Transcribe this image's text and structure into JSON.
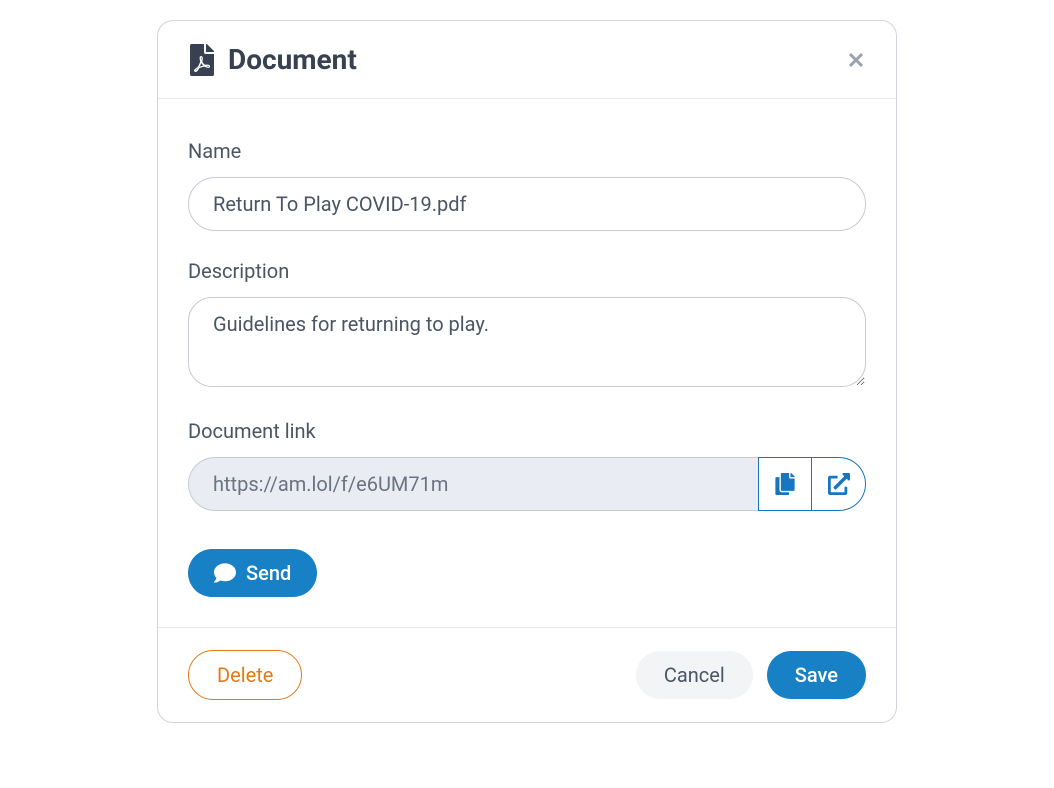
{
  "modal": {
    "title": "Document"
  },
  "form": {
    "name": {
      "label": "Name",
      "value": "Return To Play COVID-19.pdf"
    },
    "description": {
      "label": "Description",
      "value": "Guidelines for returning to play."
    },
    "link": {
      "label": "Document link",
      "value": "https://am.lol/f/e6UM71m"
    }
  },
  "actions": {
    "send": "Send",
    "delete": "Delete",
    "cancel": "Cancel",
    "save": "Save"
  }
}
